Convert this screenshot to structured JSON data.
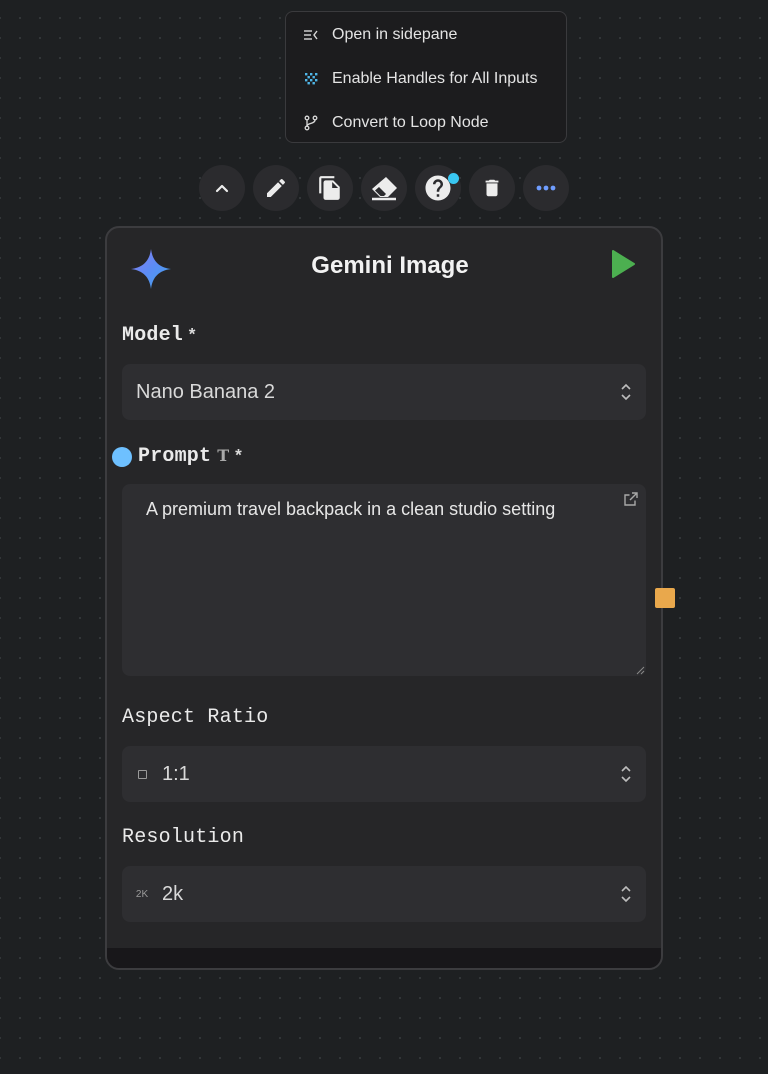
{
  "context_menu": {
    "items": [
      {
        "label": "Open in sidepane",
        "icon": "sidepane-icon"
      },
      {
        "label": "Enable Handles for All Inputs",
        "icon": "handles-grid-icon"
      },
      {
        "label": "Convert to Loop Node",
        "icon": "loop-branch-icon"
      }
    ]
  },
  "toolbar": {
    "buttons": [
      {
        "icon": "chevron-up-icon"
      },
      {
        "icon": "pencil-icon"
      },
      {
        "icon": "copy-icon"
      },
      {
        "icon": "eraser-icon"
      },
      {
        "icon": "help-icon",
        "has_notification": true
      },
      {
        "icon": "trash-icon"
      },
      {
        "icon": "more-icon"
      }
    ],
    "notification_color": "#39c7f2",
    "more_color": "#6f9dff"
  },
  "node": {
    "title": "Gemini Image",
    "icon": "gemini-sparkle-icon",
    "run_color": "#4caf50",
    "model": {
      "label": "Model",
      "required_mark": "*",
      "value": "Nano Banana 2"
    },
    "prompt": {
      "label": "Prompt",
      "type_glyph": "T",
      "required_mark": "*",
      "value": "A premium travel backpack in a clean studio setting"
    },
    "aspect_ratio": {
      "label": "Aspect Ratio",
      "value": "1:1",
      "prefix_icon": "square-icon"
    },
    "resolution": {
      "label": "Resolution",
      "prefix": "2K",
      "value": "2k"
    }
  },
  "colors": {
    "background": "#1e2022",
    "node_background": "#262628",
    "input_handle": "#6ec0ff",
    "output_handle": "#e9a84c"
  }
}
